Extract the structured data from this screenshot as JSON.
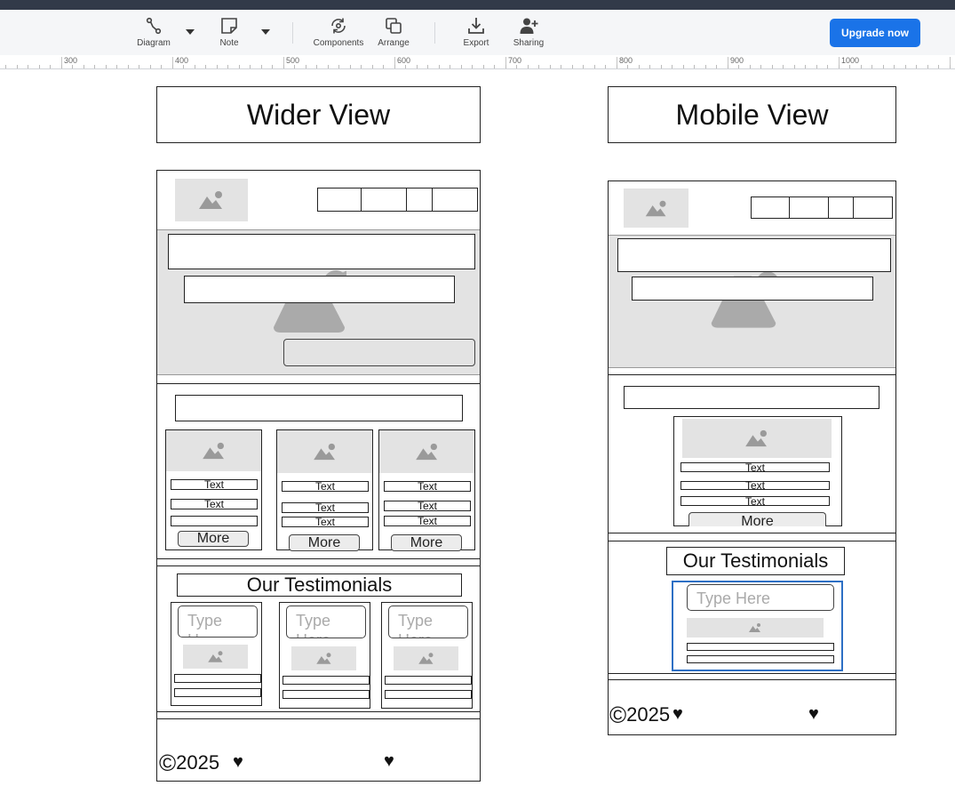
{
  "toolbar": {
    "items": [
      {
        "label": "Diagram",
        "icon": "diagram-icon"
      },
      {
        "label": "Note",
        "icon": "note-icon"
      },
      {
        "label": "Components",
        "icon": "components-icon"
      },
      {
        "label": "Arrange",
        "icon": "arrange-icon"
      },
      {
        "label": "Export",
        "icon": "export-icon"
      },
      {
        "label": "Sharing",
        "icon": "sharing-icon"
      }
    ],
    "upgrade_label": "Upgrade now",
    "accent_color": "#1a73e8"
  },
  "ruler": {
    "labels": [
      "300",
      "400",
      "500",
      "600",
      "700",
      "800",
      "900",
      "1000"
    ]
  },
  "wide": {
    "title": "Wider View",
    "cards": [
      {
        "texts": [
          "Text",
          "Text"
        ],
        "more": "More"
      },
      {
        "texts": [
          "Text",
          "Text",
          "Text"
        ],
        "more": "More"
      },
      {
        "texts": [
          "Text",
          "Text",
          "Text"
        ],
        "more": "More"
      }
    ],
    "testimonials_title": "Our Testimonials",
    "type_placeholder": "Type Here",
    "footer_year": "2025",
    "copyright_symbol": "©",
    "heart_symbol": "♥"
  },
  "mobile": {
    "title": "Mobile View",
    "card_texts": [
      "Text",
      "Text",
      "Text"
    ],
    "more": "More",
    "testimonials_title": "Our Testimonials",
    "type_placeholder": "Type Here",
    "footer_year": "2025",
    "copyright_symbol": "©",
    "heart_symbol": "♥"
  }
}
